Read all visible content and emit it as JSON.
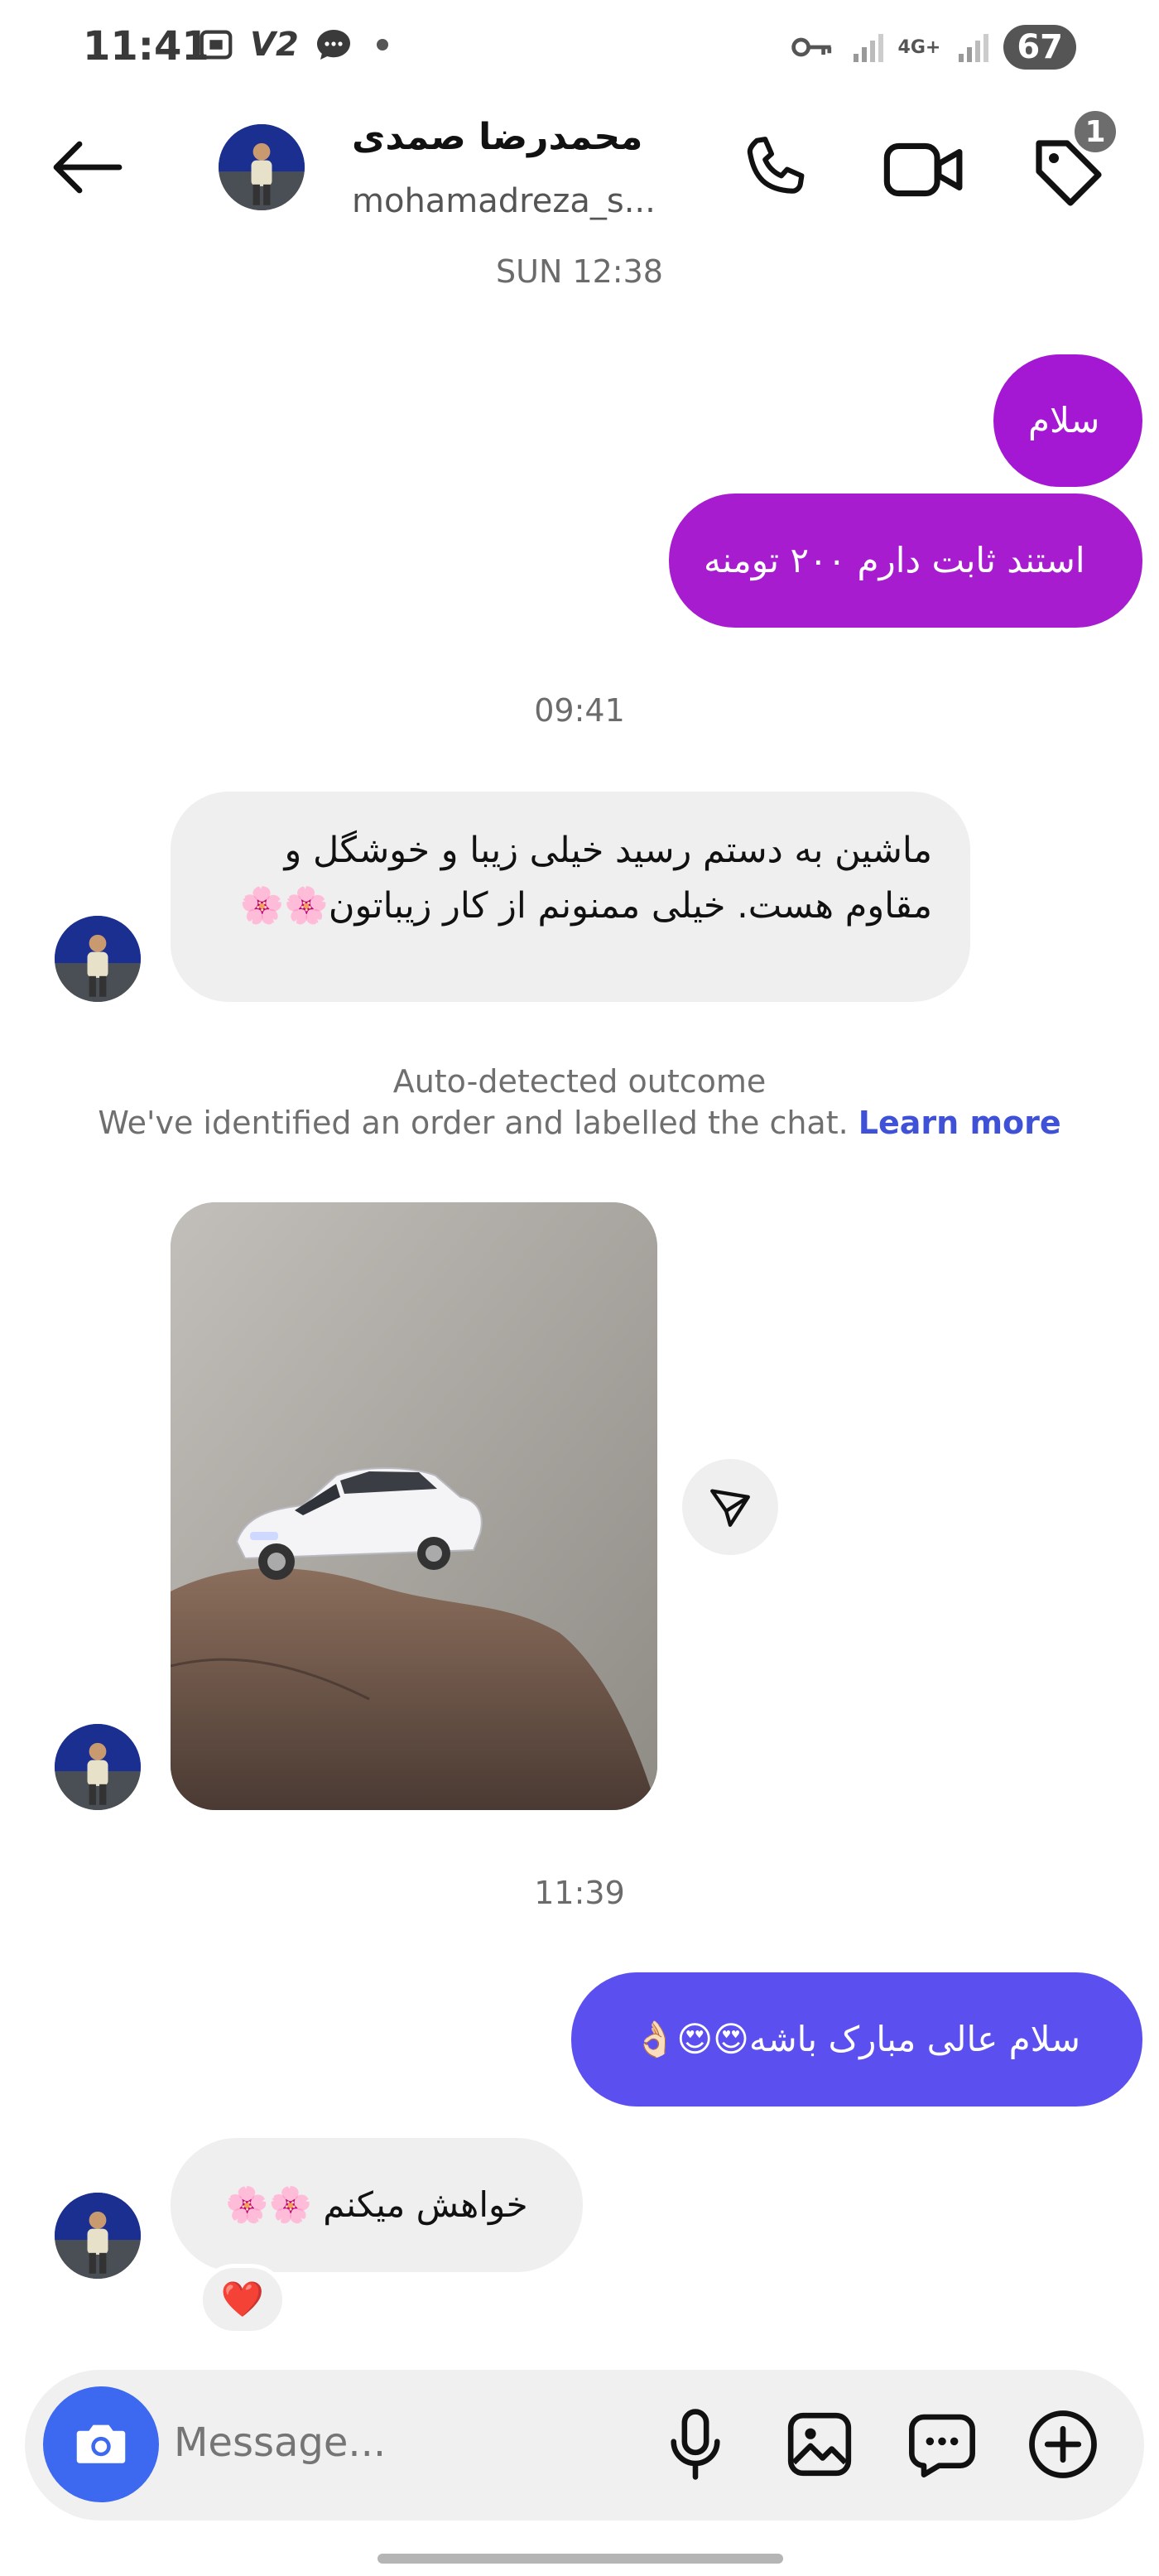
{
  "status_bar": {
    "time": "11:41",
    "carrier": "V2",
    "network": "4G+",
    "battery": "67"
  },
  "header": {
    "back_icon": "arrow-left-icon",
    "display_name": "محمدرضا صمدی",
    "username": "mohamadreza_s...",
    "call_icon": "phone-icon",
    "video_icon": "video-camera-icon",
    "label_icon": "tag-icon",
    "label_badge": "1"
  },
  "conversation": {
    "timestamp_1": "SUN 12:38",
    "msg_1": "سلام",
    "msg_2": "استند ثابت دارم ۲۰۰ تومنه",
    "timestamp_2": "09:41",
    "msg_3_line_1": "ماشین به دستم رسید خیلی زیبا و خوشگل و",
    "msg_3_line_2": "مقاوم هست. خیلی ممنونم از کار زیباتون🌸🌸",
    "notice_title": "Auto-detected outcome",
    "notice_body": "We've identified an order and labelled the chat.",
    "notice_link": "Learn more",
    "timestamp_3": "11:39",
    "msg_4": "سلام عالی مبارک باشه😍😍👌🏻",
    "msg_5": "خواهش میکنم 🌸🌸",
    "reaction": "❤️"
  },
  "composer": {
    "placeholder": "Message..."
  },
  "colors": {
    "outgoing_pink": "#a518d3",
    "outgoing_violet": "#5b4ff0",
    "incoming_gray": "#efefef",
    "camera_button": "#3d68f0",
    "link_blue": "#3f51d6"
  }
}
